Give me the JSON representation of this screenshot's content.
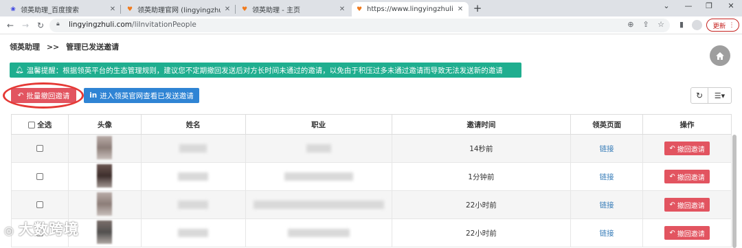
{
  "browser": {
    "tabs": [
      {
        "title": "领英助理_百度搜索",
        "icon": "baidu-paw-icon"
      },
      {
        "title": "领英助理官网 (lingyingzhuli.co",
        "icon": "lingying-logo-icon"
      },
      {
        "title": "领英助理 - 主页",
        "icon": "lingying-logo-icon"
      },
      {
        "title": "https://www.lingyingzhuli.com",
        "icon": "lingying-logo-icon",
        "active": true
      }
    ],
    "url_host": "lingyingzhuli.com",
    "url_path": "/liInvitationPeople",
    "update_label": "更新"
  },
  "breadcrumb": {
    "root": "领英助理",
    "sep": ">>",
    "current": "管理已发送邀请"
  },
  "alert": {
    "text": "温馨提醒：根据领英平台的生态管理规则，建议您不定期撤回发送后对方长时间未通过的邀请，以免由于积压过多未通过邀请而导致无法发送新的邀请"
  },
  "actions": {
    "batch_revoke": "批量撤回邀请",
    "open_linkedin": "进入领英官网查看已发送邀请"
  },
  "table": {
    "headers": {
      "select_all": "全选",
      "avatar": "头像",
      "name": "姓名",
      "job": "职业",
      "time": "邀请时间",
      "page": "领英页面",
      "ops": "操作"
    },
    "rows": [
      {
        "time": "14秒前",
        "link": "链接",
        "revoke": "撤回邀请"
      },
      {
        "time": "1分钟前",
        "link": "链接",
        "revoke": "撤回邀请"
      },
      {
        "time": "22小时前",
        "link": "链接",
        "revoke": "撤回邀请"
      },
      {
        "time": "22小时前",
        "link": "链接",
        "revoke": "撤回邀请"
      }
    ]
  },
  "watermark": "大数跨境",
  "colors": {
    "alert": "#1fae8f",
    "danger": "#e25460",
    "primary": "#2f84d4",
    "highlight_circle": "#e53935"
  }
}
